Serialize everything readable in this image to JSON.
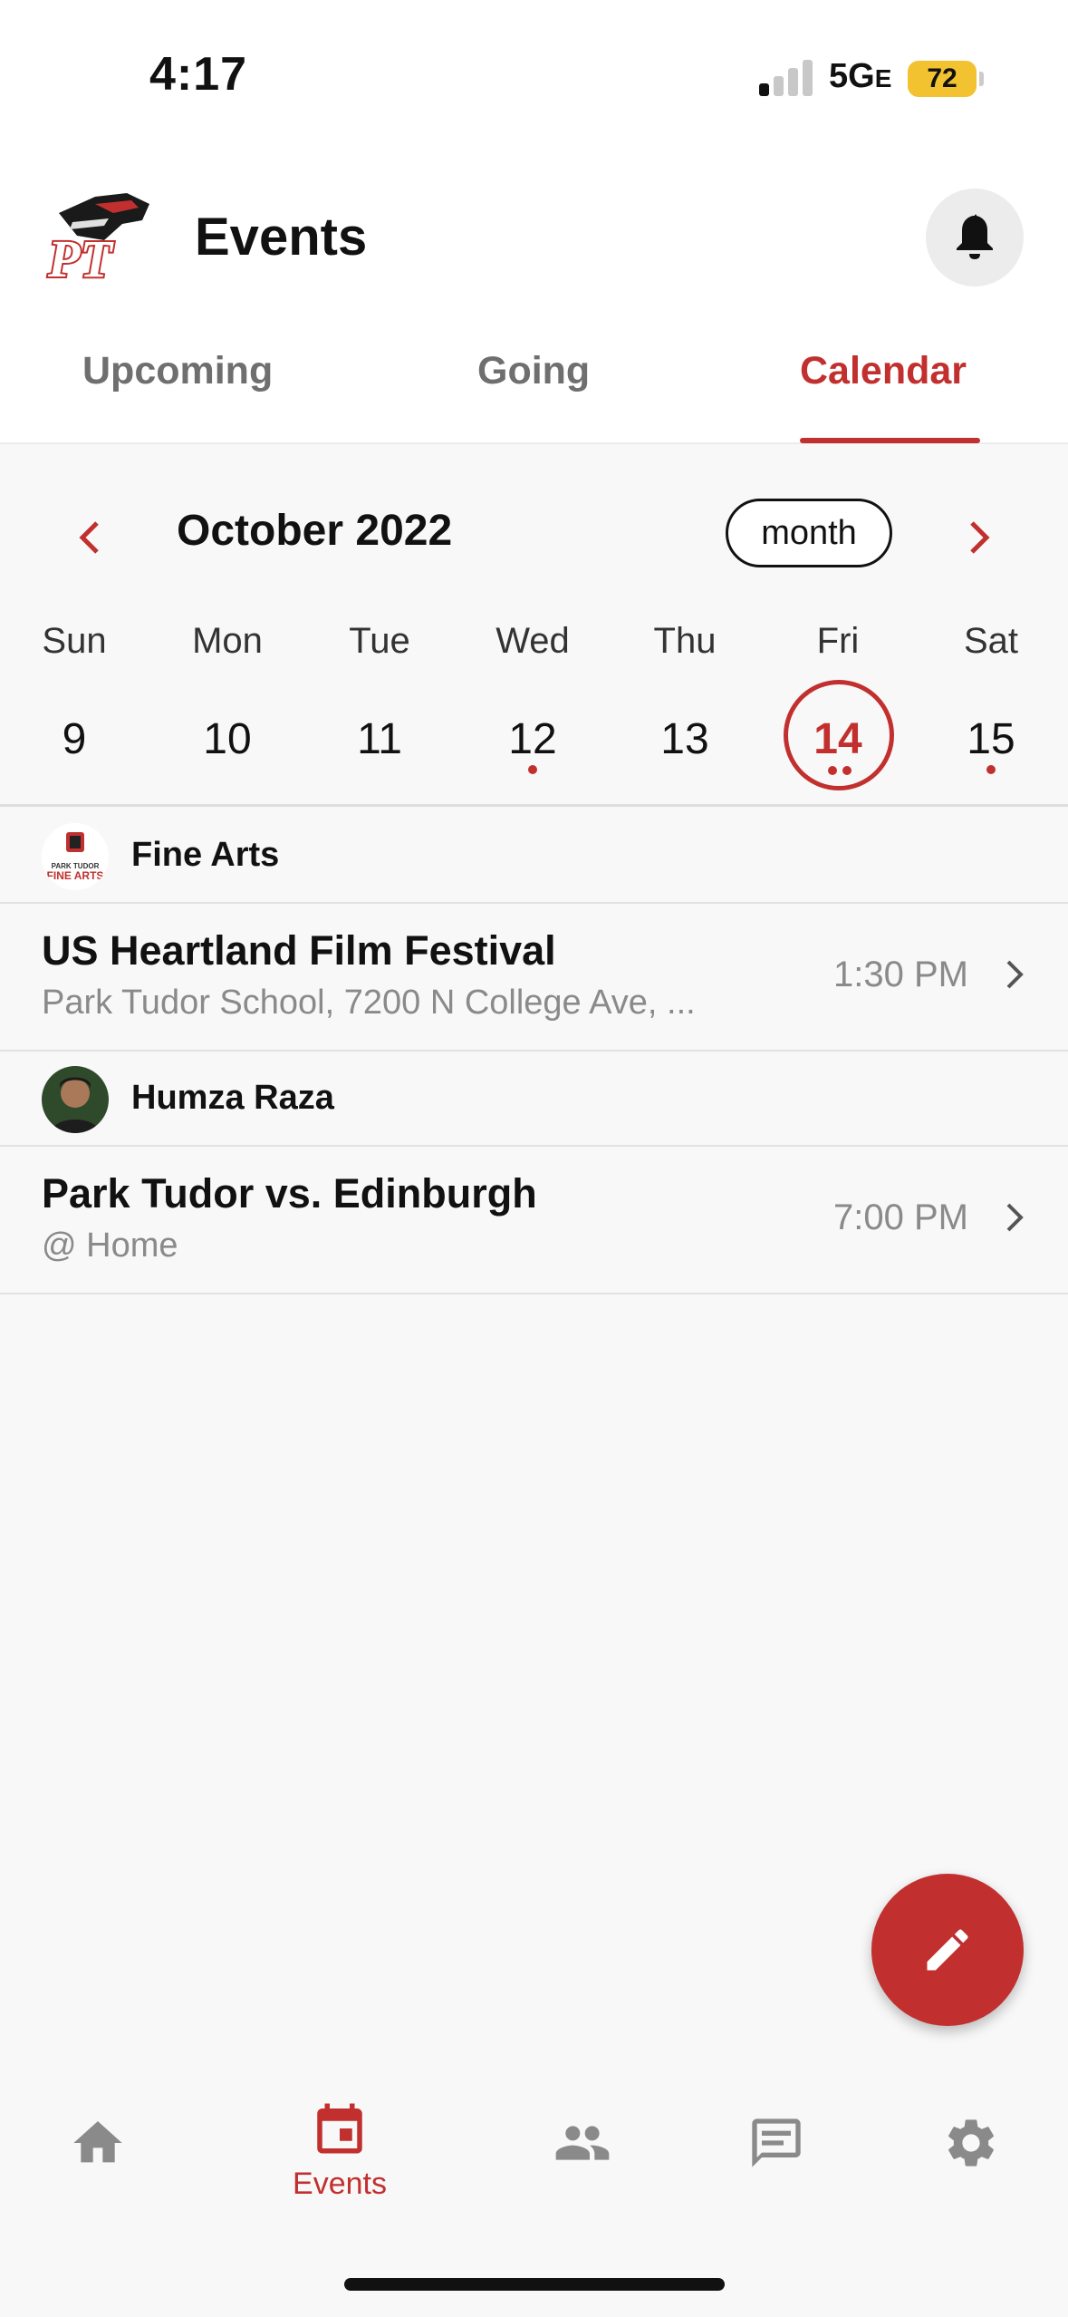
{
  "status_bar": {
    "time": "4:17",
    "network": "5G",
    "network_suffix": "E",
    "battery": "72"
  },
  "header": {
    "logo_text": "PT",
    "title": "Events",
    "bell_icon": "bell-icon"
  },
  "tabs": [
    {
      "label": "Upcoming",
      "active": false
    },
    {
      "label": "Going",
      "active": false
    },
    {
      "label": "Calendar",
      "active": true
    }
  ],
  "calendar": {
    "month_label": "October 2022",
    "view_toggle": "month",
    "weekdays": [
      "Sun",
      "Mon",
      "Tue",
      "Wed",
      "Thu",
      "Fri",
      "Sat"
    ],
    "days": [
      {
        "num": "9",
        "dots": 0
      },
      {
        "num": "10",
        "dots": 0
      },
      {
        "num": "11",
        "dots": 0
      },
      {
        "num": "12",
        "dots": 1
      },
      {
        "num": "13",
        "dots": 0
      },
      {
        "num": "14",
        "dots": 2,
        "today": true
      },
      {
        "num": "15",
        "dots": 1
      }
    ]
  },
  "groups": [
    {
      "name": "Fine Arts",
      "avatar_text": "PARK TUDOR FINE ARTS",
      "events": [
        {
          "title": "US Heartland Film Festival",
          "subtitle": "Park Tudor School, 7200 N College Ave, ...",
          "time": "1:30 PM"
        }
      ]
    },
    {
      "name": "Humza Raza",
      "events": [
        {
          "title": "Park Tudor vs. Edinburgh",
          "subtitle": "@ Home",
          "time": "7:00 PM"
        }
      ]
    }
  ],
  "fab_icon": "pencil-icon",
  "bottom_nav": [
    {
      "icon": "home-icon",
      "label": ""
    },
    {
      "icon": "calendar-icon",
      "label": "Events",
      "active": true
    },
    {
      "icon": "people-icon",
      "label": ""
    },
    {
      "icon": "chat-icon",
      "label": ""
    },
    {
      "icon": "gear-icon",
      "label": ""
    }
  ],
  "colors": {
    "accent": "#c1302e",
    "muted": "#8a8a8a",
    "tab_inactive": "#6f6f6f"
  }
}
